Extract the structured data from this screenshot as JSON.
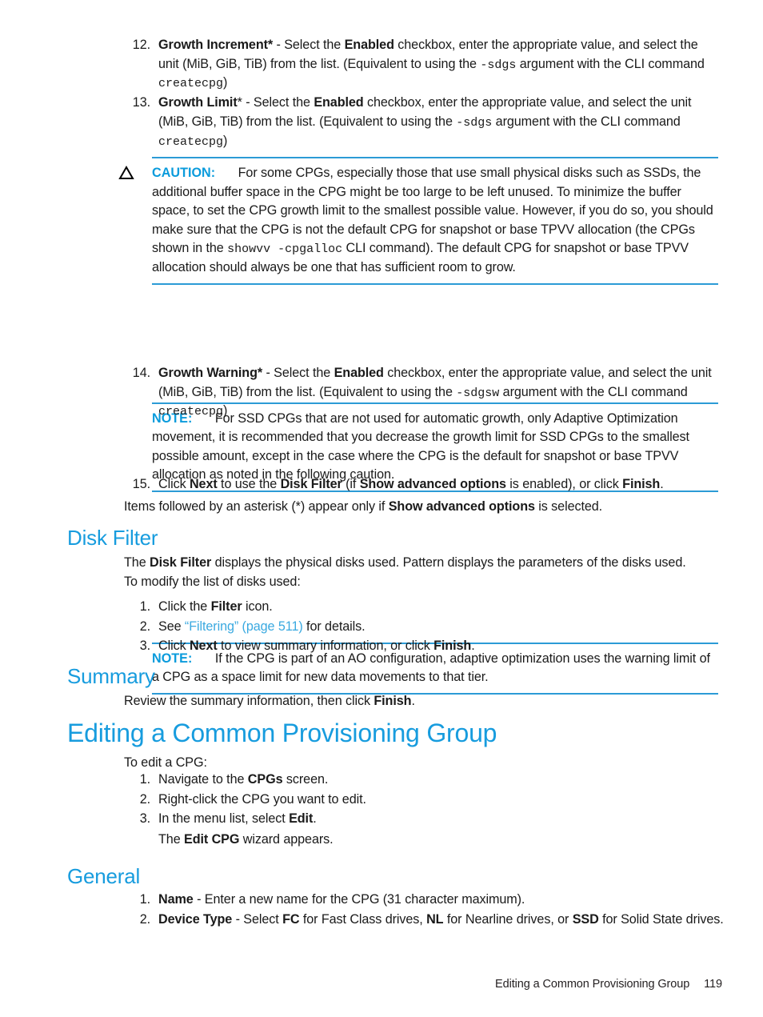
{
  "document": {
    "title": "Editing a Common Provisioning Group",
    "page_number": "119",
    "accent_color": "#179CDE",
    "admonition_rule_color": "#2C9BD6",
    "link_color": "#3AA9E0"
  },
  "steps_12_13": [
    {
      "marker": "12.",
      "segments": [
        {
          "t": "Growth Increment*",
          "s": "bold"
        },
        {
          "t": " - Select the ",
          "s": "normal"
        },
        {
          "t": "Enabled",
          "s": "bold"
        },
        {
          "t": " checkbox, enter the appropriate value, and select the unit (MiB, GiB, TiB) from the list. (Equivalent to using the ",
          "s": "normal"
        },
        {
          "t": "-sdgs",
          "s": "mono"
        },
        {
          "t": " argument with the CLI command ",
          "s": "normal"
        },
        {
          "t": "createcpg",
          "s": "mono"
        },
        {
          "t": ")",
          "s": "normal"
        }
      ]
    },
    {
      "marker": "13.",
      "segments": [
        {
          "t": "Growth Limit",
          "s": "bold"
        },
        {
          "t": "*",
          "s": "normal"
        },
        {
          "t": " - Select the ",
          "s": "normal"
        },
        {
          "t": "Enabled",
          "s": "bold"
        },
        {
          "t": " checkbox, enter the appropriate value, and select the unit (MiB, GiB, TiB) from the list. (Equivalent to using the ",
          "s": "normal"
        },
        {
          "t": "-sdgs",
          "s": "mono"
        },
        {
          "t": " argument with the CLI command ",
          "s": "normal"
        },
        {
          "t": "createcpg",
          "s": "mono"
        },
        {
          "t": ")",
          "s": "normal"
        }
      ]
    }
  ],
  "caution_1": {
    "icon": "warning-triangle-icon",
    "label": "CAUTION:",
    "segments": [
      {
        "t": "For some CPGs, especially those that use small physical disks such as SSDs, the additional buffer space in the CPG might be too large to be left unused. To minimize the buffer space, to set the CPG growth limit to the smallest possible value. However, if you do so, you should make sure that the CPG is not the default CPG for snapshot or base TPVV allocation (the CPGs shown in the ",
        "s": "normal"
      },
      {
        "t": "showvv -cpgalloc",
        "s": "mono"
      },
      {
        "t": " CLI command). The default CPG for snapshot or base TPVV allocation should always be one that has sufficient room to grow.",
        "s": "normal"
      }
    ]
  },
  "note_1": {
    "label": "NOTE:",
    "text": "For SSD CPGs that are not used for automatic growth, only Adaptive Optimization movement, it is recommended that you decrease the growth limit for SSD CPGs to the smallest possible amount, except in the case where the CPG is the default for snapshot or base TPVV allocation as noted in the following caution."
  },
  "step_14": {
    "marker": "14.",
    "segments": [
      {
        "t": "Growth Warning*",
        "s": "bold"
      },
      {
        "t": " - Select the ",
        "s": "normal"
      },
      {
        "t": "Enabled",
        "s": "bold"
      },
      {
        "t": " checkbox, enter the appropriate value, and select the unit (MiB, GiB, TiB) from the list. (Equivalent to using the ",
        "s": "normal"
      },
      {
        "t": "-sdgsw",
        "s": "mono"
      },
      {
        "t": " argument with the CLI command ",
        "s": "normal"
      },
      {
        "t": "createcpg",
        "s": "mono"
      },
      {
        "t": ")",
        "s": "normal"
      }
    ]
  },
  "note_2": {
    "label": "NOTE:",
    "text": "If the CPG is part of an AO configuration, adaptive optimization uses the warning limit of a CPG as a space limit for new data movements to that tier."
  },
  "step_15": {
    "marker": "15.",
    "segments": [
      {
        "t": "Click ",
        "s": "normal"
      },
      {
        "t": "Next",
        "s": "bold"
      },
      {
        "t": " to use the ",
        "s": "normal"
      },
      {
        "t": "Disk Filter",
        "s": "bold"
      },
      {
        "t": " (if ",
        "s": "normal"
      },
      {
        "t": "Show advanced options",
        "s": "bold"
      },
      {
        "t": " is enabled), or click ",
        "s": "normal"
      },
      {
        "t": "Finish",
        "s": "bold"
      },
      {
        "t": ".",
        "s": "normal"
      }
    ]
  },
  "asterisk_note": {
    "segments": [
      {
        "t": "Items followed by an asterisk (*) appear only if ",
        "s": "normal"
      },
      {
        "t": "Show advanced options",
        "s": "bold"
      },
      {
        "t": " is selected.",
        "s": "normal"
      }
    ]
  },
  "disk_filter": {
    "heading": "Disk Filter",
    "paragraph": [
      {
        "t": "The ",
        "s": "normal"
      },
      {
        "t": "Disk Filter",
        "s": "bold"
      },
      {
        "t": " displays the physical disks used. Pattern displays the parameters of the disks used.",
        "s": "normal"
      }
    ],
    "intro": "To modify the list of disks used:",
    "steps": [
      {
        "marker": "1.",
        "segments": [
          {
            "t": "Click the ",
            "s": "normal"
          },
          {
            "t": "Filter",
            "s": "bold"
          },
          {
            "t": " icon.",
            "s": "normal"
          }
        ]
      },
      {
        "marker": "2.",
        "segments": [
          {
            "t": "See ",
            "s": "normal"
          },
          {
            "t": "“Filtering” (page 511)",
            "s": "link"
          },
          {
            "t": " for details.",
            "s": "normal"
          }
        ]
      },
      {
        "marker": "3.",
        "segments": [
          {
            "t": "Click ",
            "s": "normal"
          },
          {
            "t": "Next",
            "s": "bold"
          },
          {
            "t": " to view summary information, or click ",
            "s": "normal"
          },
          {
            "t": "Finish",
            "s": "bold"
          },
          {
            "t": ".",
            "s": "normal"
          }
        ]
      }
    ]
  },
  "summary": {
    "heading": "Summary",
    "paragraph": [
      {
        "t": "Review the summary information, then click ",
        "s": "normal"
      },
      {
        "t": "Finish",
        "s": "bold"
      },
      {
        "t": ".",
        "s": "normal"
      }
    ]
  },
  "editing": {
    "heading": "Editing a Common Provisioning Group",
    "intro": "To edit a CPG:",
    "steps": [
      {
        "marker": "1.",
        "segments": [
          {
            "t": "Navigate to the ",
            "s": "normal"
          },
          {
            "t": "CPGs",
            "s": "bold"
          },
          {
            "t": " screen.",
            "s": "normal"
          }
        ]
      },
      {
        "marker": "2.",
        "segments": [
          {
            "t": "Right-click the CPG you want to edit.",
            "s": "normal"
          }
        ]
      },
      {
        "marker": "3.",
        "segments": [
          {
            "t": "In the menu list, select ",
            "s": "normal"
          },
          {
            "t": "Edit",
            "s": "bold"
          },
          {
            "t": ".",
            "s": "normal"
          }
        ]
      }
    ],
    "wizard_line": [
      {
        "t": "The ",
        "s": "normal"
      },
      {
        "t": "Edit CPG",
        "s": "bold"
      },
      {
        "t": " wizard appears.",
        "s": "normal"
      }
    ]
  },
  "general": {
    "heading": "General",
    "steps": [
      {
        "marker": "1.",
        "segments": [
          {
            "t": "Name",
            "s": "bold"
          },
          {
            "t": " - Enter a new name for the CPG (31 character maximum).",
            "s": "normal"
          }
        ]
      },
      {
        "marker": "2.",
        "segments": [
          {
            "t": "Device Type",
            "s": "bold"
          },
          {
            "t": " - Select ",
            "s": "normal"
          },
          {
            "t": "FC",
            "s": "bold"
          },
          {
            "t": " for Fast Class drives, ",
            "s": "normal"
          },
          {
            "t": "NL",
            "s": "bold"
          },
          {
            "t": " for Nearline drives, or ",
            "s": "normal"
          },
          {
            "t": "SSD",
            "s": "bold"
          },
          {
            "t": " for Solid State drives.",
            "s": "normal"
          }
        ]
      }
    ]
  },
  "footer": {
    "chapter_title": "Editing a Common Provisioning Group",
    "page": "119"
  }
}
